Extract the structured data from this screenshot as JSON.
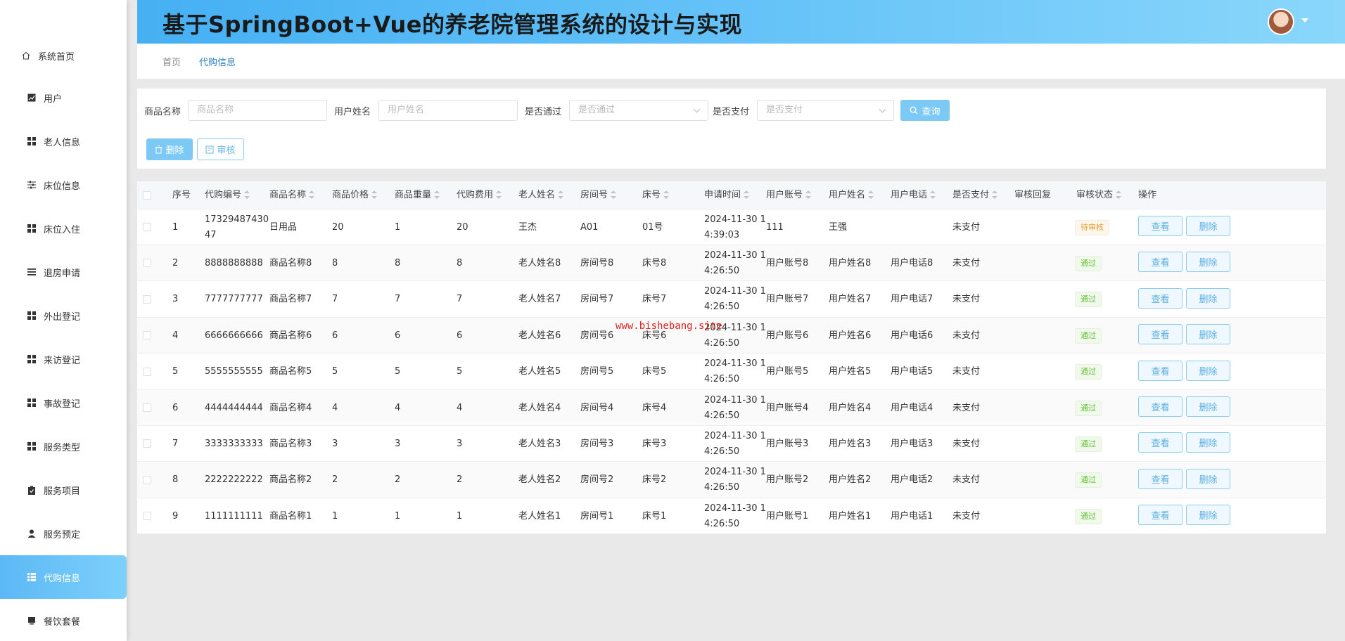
{
  "app": {
    "title": "基于SpringBoot+Vue的养老院管理系统的设计与实现"
  },
  "sidebar": {
    "items": [
      {
        "label": "系统首页",
        "icon": "home-icon"
      },
      {
        "label": "用户",
        "icon": "chart-icon"
      },
      {
        "label": "老人信息",
        "icon": "grid-icon"
      },
      {
        "label": "床位信息",
        "icon": "sliders-icon"
      },
      {
        "label": "床位入住",
        "icon": "grid-icon"
      },
      {
        "label": "退房申请",
        "icon": "list-icon"
      },
      {
        "label": "外出登记",
        "icon": "grid-icon"
      },
      {
        "label": "来访登记",
        "icon": "grid-icon"
      },
      {
        "label": "事故登记",
        "icon": "grid-icon"
      },
      {
        "label": "服务类型",
        "icon": "grid-icon"
      },
      {
        "label": "服务项目",
        "icon": "clipboard-icon"
      },
      {
        "label": "服务预定",
        "icon": "user-icon"
      },
      {
        "label": "代购信息",
        "icon": "table-icon",
        "active": true
      },
      {
        "label": "餐饮套餐",
        "icon": "box-icon"
      }
    ]
  },
  "breadcrumb": {
    "home": "首页",
    "current": "代购信息"
  },
  "search": {
    "product_name_label": "商品名称",
    "product_name_placeholder": "商品名称",
    "user_name_label": "用户姓名",
    "user_name_placeholder": "用户姓名",
    "approved_label": "是否通过",
    "approved_placeholder": "是否通过",
    "paid_label": "是否支付",
    "paid_placeholder": "是否支付",
    "query_button": "查询",
    "delete_button": "删除",
    "audit_button": "审核"
  },
  "table": {
    "columns": [
      "序号",
      "代购编号",
      "商品名称",
      "商品价格",
      "商品重量",
      "代购费用",
      "老人姓名",
      "房间号",
      "床号",
      "申请时间",
      "用户账号",
      "用户姓名",
      "用户电话",
      "是否支付",
      "审核回复",
      "审核状态",
      "操作"
    ],
    "view_label": "查看",
    "delete_label": "删除",
    "rows": [
      {
        "index": "1",
        "code_l1": "17329487430",
        "code_l2": "47",
        "product": "日用品",
        "price": "20",
        "weight": "1",
        "fee": "20",
        "elder": "王杰",
        "room": "A01",
        "bed": "01号",
        "time_l1": "2024-11-30 1",
        "time_l2": "4:39:03",
        "account": "111",
        "user": "王强",
        "phone": "",
        "paid": "未支付",
        "reply": "",
        "status": "待审核",
        "status_type": "pending"
      },
      {
        "index": "2",
        "code_l1": "8888888888",
        "code_l2": "",
        "product": "商品名称8",
        "price": "8",
        "weight": "8",
        "fee": "8",
        "elder": "老人姓名8",
        "room": "房间号8",
        "bed": "床号8",
        "time_l1": "2024-11-30 1",
        "time_l2": "4:26:50",
        "account": "用户账号8",
        "user": "用户姓名8",
        "phone": "用户电话8",
        "paid": "未支付",
        "reply": "",
        "status": "通过",
        "status_type": "passed"
      },
      {
        "index": "3",
        "code_l1": "7777777777",
        "code_l2": "",
        "product": "商品名称7",
        "price": "7",
        "weight": "7",
        "fee": "7",
        "elder": "老人姓名7",
        "room": "房间号7",
        "bed": "床号7",
        "time_l1": "2024-11-30 1",
        "time_l2": "4:26:50",
        "account": "用户账号7",
        "user": "用户姓名7",
        "phone": "用户电话7",
        "paid": "未支付",
        "reply": "",
        "status": "通过",
        "status_type": "passed"
      },
      {
        "index": "4",
        "code_l1": "6666666666",
        "code_l2": "",
        "product": "商品名称6",
        "price": "6",
        "weight": "6",
        "fee": "6",
        "elder": "老人姓名6",
        "room": "房间号6",
        "bed": "床号6",
        "time_l1": "2024-11-30 1",
        "time_l2": "4:26:50",
        "account": "用户账号6",
        "user": "用户姓名6",
        "phone": "用户电话6",
        "paid": "未支付",
        "reply": "",
        "status": "通过",
        "status_type": "passed"
      },
      {
        "index": "5",
        "code_l1": "5555555555",
        "code_l2": "",
        "product": "商品名称5",
        "price": "5",
        "weight": "5",
        "fee": "5",
        "elder": "老人姓名5",
        "room": "房间号5",
        "bed": "床号5",
        "time_l1": "2024-11-30 1",
        "time_l2": "4:26:50",
        "account": "用户账号5",
        "user": "用户姓名5",
        "phone": "用户电话5",
        "paid": "未支付",
        "reply": "",
        "status": "通过",
        "status_type": "passed"
      },
      {
        "index": "6",
        "code_l1": "4444444444",
        "code_l2": "",
        "product": "商品名称4",
        "price": "4",
        "weight": "4",
        "fee": "4",
        "elder": "老人姓名4",
        "room": "房间号4",
        "bed": "床号4",
        "time_l1": "2024-11-30 1",
        "time_l2": "4:26:50",
        "account": "用户账号4",
        "user": "用户姓名4",
        "phone": "用户电话4",
        "paid": "未支付",
        "reply": "",
        "status": "通过",
        "status_type": "passed"
      },
      {
        "index": "7",
        "code_l1": "3333333333",
        "code_l2": "",
        "product": "商品名称3",
        "price": "3",
        "weight": "3",
        "fee": "3",
        "elder": "老人姓名3",
        "room": "房间号3",
        "bed": "床号3",
        "time_l1": "2024-11-30 1",
        "time_l2": "4:26:50",
        "account": "用户账号3",
        "user": "用户姓名3",
        "phone": "用户电话3",
        "paid": "未支付",
        "reply": "",
        "status": "通过",
        "status_type": "passed"
      },
      {
        "index": "8",
        "code_l1": "2222222222",
        "code_l2": "",
        "product": "商品名称2",
        "price": "2",
        "weight": "2",
        "fee": "2",
        "elder": "老人姓名2",
        "room": "房间号2",
        "bed": "床号2",
        "time_l1": "2024-11-30 1",
        "time_l2": "4:26:50",
        "account": "用户账号2",
        "user": "用户姓名2",
        "phone": "用户电话2",
        "paid": "未支付",
        "reply": "",
        "status": "通过",
        "status_type": "passed"
      },
      {
        "index": "9",
        "code_l1": "1111111111",
        "code_l2": "",
        "product": "商品名称1",
        "price": "1",
        "weight": "1",
        "fee": "1",
        "elder": "老人姓名1",
        "room": "房间号1",
        "bed": "床号1",
        "time_l1": "2024-11-30 1",
        "time_l2": "4:26:50",
        "account": "用户账号1",
        "user": "用户姓名1",
        "phone": "用户电话1",
        "paid": "未支付",
        "reply": "",
        "status": "通过",
        "status_type": "passed"
      }
    ]
  },
  "watermark": "www.bishebang.site",
  "colors": {
    "accent": "#4ab3f4",
    "pending": "#e6a23c",
    "passed": "#67c23a"
  }
}
